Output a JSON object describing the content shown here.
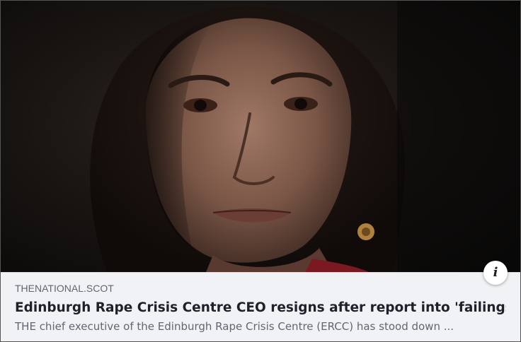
{
  "link_preview": {
    "image": {
      "description": "Close-up portrait photo of a woman with dark hair and earring against a dark background"
    },
    "info_button": {
      "icon": "info-icon",
      "glyph": "i"
    },
    "domain": "THENATIONAL.SCOT",
    "headline": "Edinburgh Rape Crisis Centre CEO resigns after report into 'failings'",
    "description": "THE chief executive of the Edinburgh Rape Crisis Centre (ERCC) has stood down ..."
  },
  "colors": {
    "card_background": "#f0f2f5",
    "domain_text": "#606770",
    "headline_text": "#1d2129",
    "description_text": "#606770",
    "border": "#555555"
  }
}
